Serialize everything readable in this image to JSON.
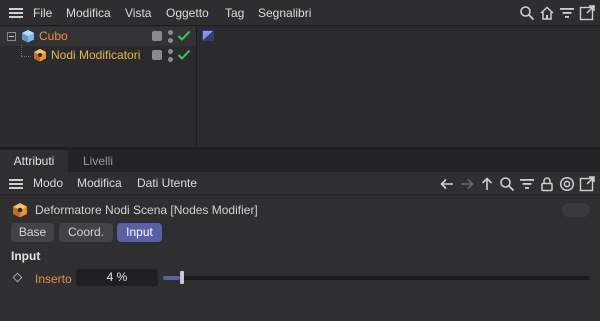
{
  "object_manager": {
    "menu": [
      "File",
      "Modifica",
      "Vista",
      "Oggetto",
      "Tag",
      "Segnalibri"
    ],
    "toolbar_icons": [
      "search-icon",
      "home-icon",
      "filter-icon",
      "expand-icon"
    ],
    "objects": [
      {
        "name": "Cubo",
        "icon": "cube-icon",
        "color": "#e8903a",
        "selected": true,
        "enabled": true
      },
      {
        "name": "Nodi Modificatori",
        "icon": "nodes-modifier-icon",
        "color": "#e8b64a",
        "selected": false,
        "enabled": true
      }
    ],
    "tag_icon": "tag-flag-icon"
  },
  "attributes": {
    "tabs": [
      "Attributi",
      "Livelli"
    ],
    "active_tab": "Attributi",
    "menu": [
      "Modo",
      "Modifica",
      "Dati Utente"
    ],
    "toolbar_icons": [
      "arrow-back-icon",
      "arrow-forward-icon",
      "arrow-up-icon",
      "search-icon",
      "filter-icon",
      "lock-icon",
      "target-icon",
      "expand-icon"
    ],
    "object_title": "Deformatore Nodi Scena [Nodes Modifier]",
    "sub_tabs": [
      "Base",
      "Coord.",
      "Input"
    ],
    "active_sub_tab": "Input",
    "section_title": "Input",
    "params": [
      {
        "label": "Inserto",
        "value": "4 %",
        "fraction": 0.04
      }
    ]
  },
  "colors": {
    "accent": "#5a5fa6",
    "check": "#3ec85a",
    "orange": "#e8903a"
  }
}
